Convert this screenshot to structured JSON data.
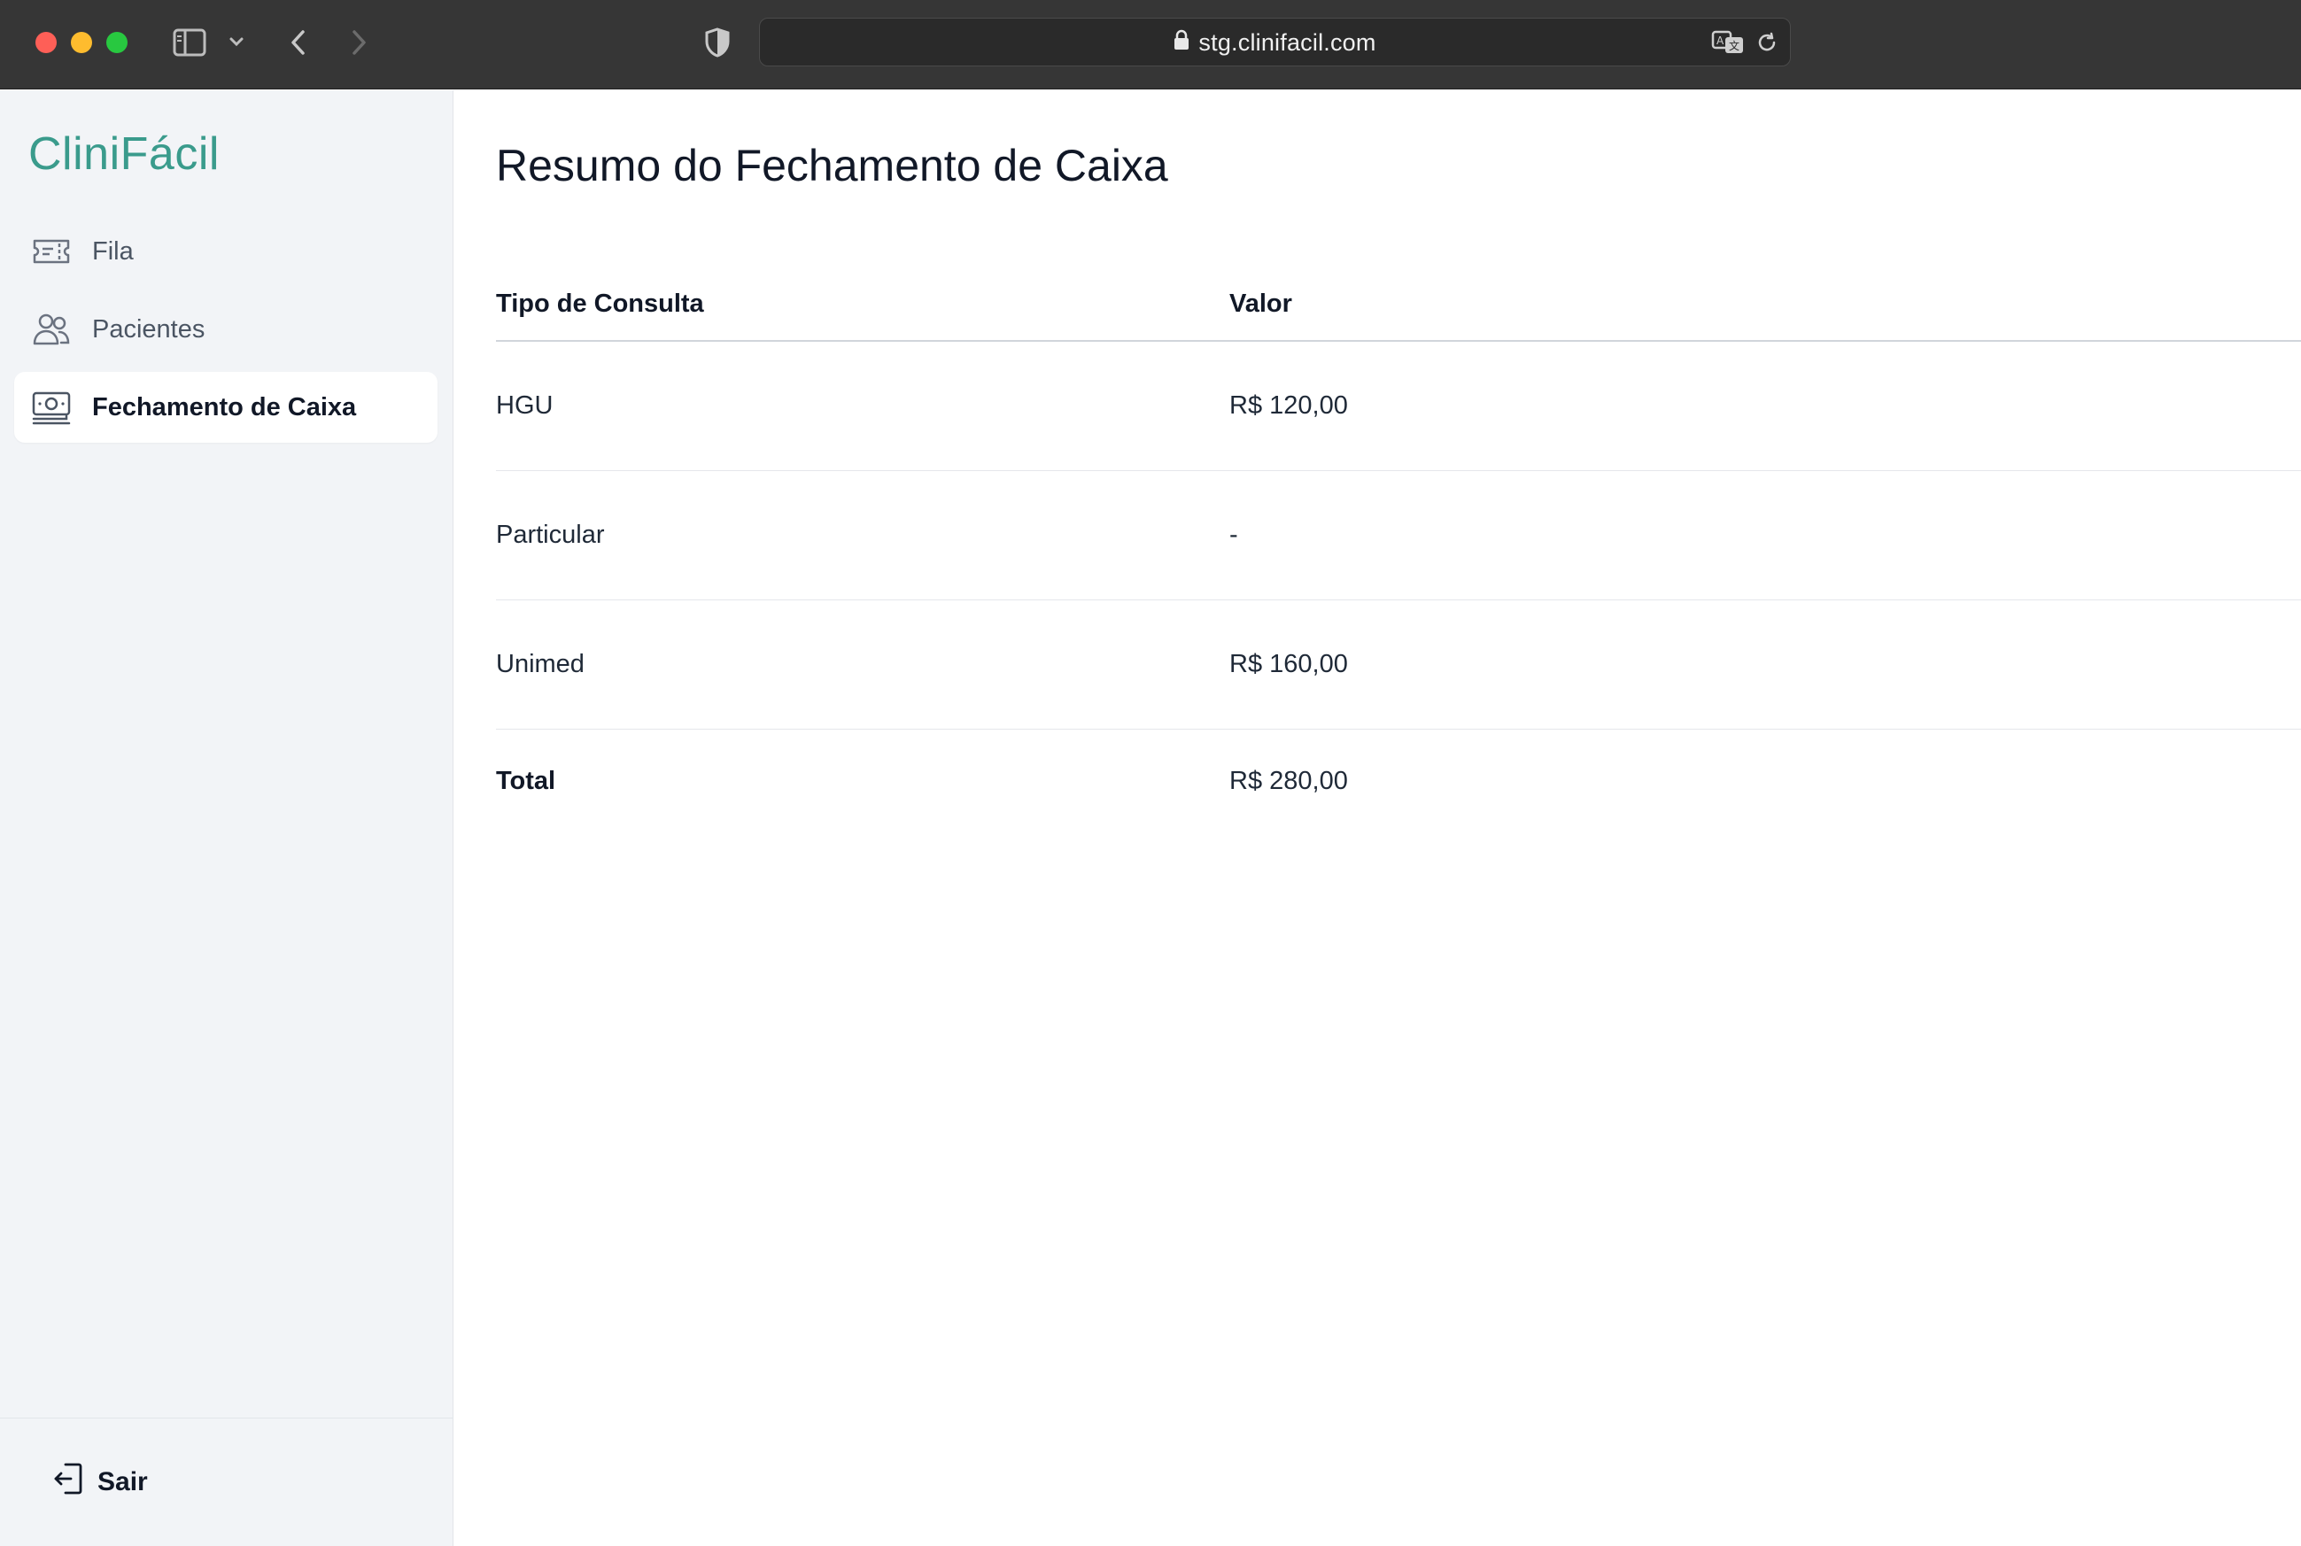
{
  "browser": {
    "url": "stg.clinifacil.com"
  },
  "sidebar": {
    "logo": "CliniFácil",
    "items": [
      {
        "label": "Fila",
        "icon": "ticket-icon",
        "active": false
      },
      {
        "label": "Pacientes",
        "icon": "users-icon",
        "active": false
      },
      {
        "label": "Fechamento de Caixa",
        "icon": "cash-icon",
        "active": true
      }
    ],
    "logout_label": "Sair"
  },
  "main": {
    "title": "Resumo do Fechamento de Caixa",
    "table": {
      "headers": [
        "Tipo de Consulta",
        "Valor"
      ],
      "rows": [
        {
          "tipo": "HGU",
          "valor": "R$ 120,00"
        },
        {
          "tipo": "Particular",
          "valor": "-"
        },
        {
          "tipo": "Unimed",
          "valor": "R$ 160,00"
        }
      ],
      "total": {
        "label": "Total",
        "valor": "R$ 280,00"
      }
    }
  },
  "colors": {
    "brand": "#3a9b8c",
    "sidebar_bg": "#f2f4f7",
    "chrome_bg": "#363636"
  }
}
